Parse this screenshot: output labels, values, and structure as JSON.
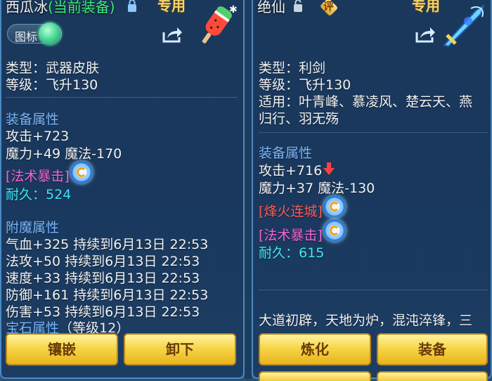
{
  "left": {
    "title": "西瓜冰",
    "title_status": "(当前装备)",
    "exclusive_label": "专用",
    "toggle_label": "图标",
    "type": "类型：武器皮肤",
    "level": "等级：飞升130",
    "equip_section": "装备属性",
    "attack": "攻击+723",
    "magic": "魔力+49 魔法-170",
    "skill": "[法术暴击]",
    "durability_label": "耐久：",
    "durability_value": "524",
    "enchant_section": "附魔属性",
    "enchants": [
      "气血+325 持续到6月13日 22:53",
      "法攻+50 持续到6月13日 22:53",
      "速度+33 持续到6月13日 22:53",
      "防御+161 持续到6月13日 22:53",
      "伤害+53 持续到6月13日 22:53"
    ],
    "gem_section": "宝石属性",
    "gem_level": "（等级12）",
    "buttons": [
      "镶嵌",
      "卸下"
    ]
  },
  "right": {
    "title": "绝仙",
    "badge": "评",
    "exclusive_label": "专用",
    "type": "类型：利剑",
    "level": "等级：飞升130",
    "applies_line1": "适用：叶青峰、慕凌风、楚云天、燕",
    "applies_line2": "归行、羽无殇",
    "equip_section": "装备属性",
    "attack": "攻击+716",
    "magic": "魔力+37 魔法-130",
    "skill1": "[烽火连城]",
    "skill2": "[法术暴击]",
    "durability_label": "耐久：",
    "durability_value": "615",
    "description": "大道初辟，天地为炉，混沌淬锋，三",
    "buttons": [
      "炼化",
      "装备"
    ]
  },
  "colors": {
    "section": "#79b7ff",
    "skill": "#f564d6",
    "skill_special": "#ff5a5a",
    "durability": "#3fe8f5",
    "status_green": "#3cf07a",
    "button_gold": "#f7d64a"
  },
  "icons": [
    "lock-icon",
    "share-icon",
    "popsicle-icon",
    "sword-icon",
    "unlock-icon",
    "appraise-badge-icon",
    "refresh-spin-icon",
    "down-arrow-icon"
  ]
}
